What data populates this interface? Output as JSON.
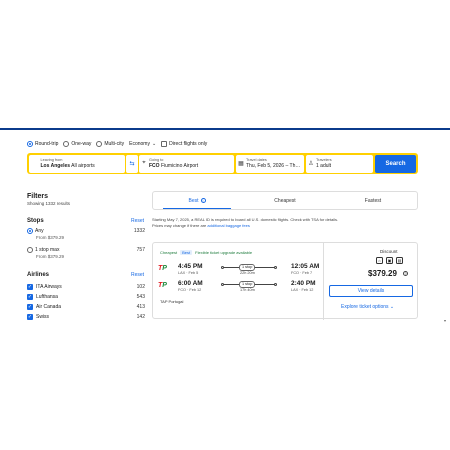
{
  "trip_options": {
    "round_trip": "Round-trip",
    "one_way": "One-way",
    "multi_city": "Multi-city",
    "cabin": "Economy",
    "direct_only": "Direct flights only"
  },
  "search": {
    "from_label": "Leaving from",
    "from_city": "Los Angeles",
    "from_value": "All airports",
    "to_label": "Going to",
    "to_code": "FCO",
    "to_value": "Fiumicino Airport",
    "dates_label": "Travel dates",
    "dates_value": "Thu, Feb 5, 2026 – Th…",
    "travelers_label": "Travelers",
    "travelers_value": "1 adult",
    "search_button": "Search"
  },
  "filters": {
    "title": "Filters",
    "showing": "Showing 1332 results",
    "stops": {
      "title": "Stops",
      "reset": "Reset",
      "items": [
        {
          "label": "Any",
          "from": "From $379.29",
          "count": "1332"
        },
        {
          "label": "1 stop max",
          "from": "From $379.29",
          "count": "757"
        }
      ]
    },
    "airlines": {
      "title": "Airlines",
      "reset": "Reset",
      "items": [
        {
          "label": "ITA Airways",
          "count": "102"
        },
        {
          "label": "Lufthansa",
          "count": "543"
        },
        {
          "label": "Air Canada",
          "count": "413"
        },
        {
          "label": "Swiss",
          "count": "142"
        }
      ]
    }
  },
  "sort_tabs": [
    "Best",
    "Cheapest",
    "Fastest"
  ],
  "notice": {
    "text": "Starting May 7, 2025, a REAL ID is required to board all U.S. domestic flights. Check with TSA for details.",
    "text2": "Prices may change if there are",
    "link": "additional baggage fees"
  },
  "result": {
    "badges": [
      "Cheapest",
      "Best",
      "Flexible ticket upgrade available"
    ],
    "outbound": {
      "dep_time": "4:45 PM",
      "dep_info": "LAX · Feb 5",
      "stops": "1 stop",
      "duration": "22h 20m",
      "arr_time": "12:05 AM",
      "arr_info": "FCO · Feb 7"
    },
    "inbound": {
      "dep_time": "6:00 AM",
      "dep_info": "FCO · Feb 12",
      "stops": "1 stop",
      "duration": "17h 40m",
      "arr_time": "2:40 PM",
      "arr_info": "LAX · Feb 12"
    },
    "carrier": "TAP Portugal",
    "discount": "Discount",
    "price": "$379.29",
    "view_details": "View details",
    "explore": "Explore ticket options"
  },
  "colors": {
    "accent": "#1668e3",
    "search_border": "#ffd000",
    "header_bar": "#0b3b8c"
  }
}
